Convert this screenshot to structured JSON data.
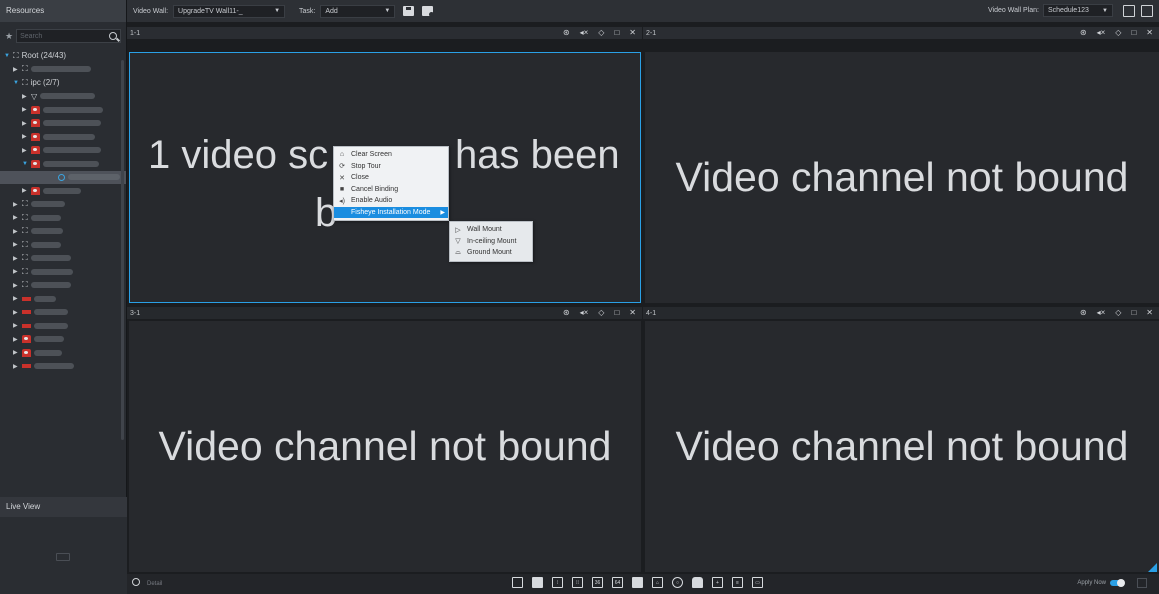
{
  "left_panel": {
    "title": "Resources",
    "search_placeholder": "Search",
    "tree": [
      {
        "label": "Root (24/43)",
        "level": 0,
        "icon": "network-icon",
        "open": true
      },
      {
        "label": "",
        "level": 1,
        "icon": "network-icon",
        "open": false,
        "blurred": true
      },
      {
        "label": "ipc (2/7)",
        "level": 1,
        "icon": "network-icon",
        "open": true
      },
      {
        "label": "",
        "level": 2,
        "icon": "fisheye-camera-icon",
        "open": false,
        "blurred": true
      },
      {
        "label": "",
        "level": 2,
        "icon": "red-camera-icon",
        "open": false,
        "blurred": true
      },
      {
        "label": "",
        "level": 2,
        "icon": "red-camera-icon",
        "open": false,
        "blurred": true
      },
      {
        "label": "",
        "level": 2,
        "icon": "red-camera-icon",
        "open": false,
        "blurred": true
      },
      {
        "label": "",
        "level": 2,
        "icon": "red-camera-icon",
        "open": false,
        "blurred": true
      },
      {
        "label": "",
        "level": 2,
        "icon": "red-camera-icon",
        "open": true,
        "blurred": true
      },
      {
        "label": "",
        "level": 3,
        "icon": "channel-icon",
        "selected": true,
        "blurred": true
      },
      {
        "label": "",
        "level": 2,
        "icon": "red-camera-icon",
        "open": false,
        "blurred": true
      },
      {
        "label": "",
        "level": 1,
        "icon": "network-icon",
        "open": false,
        "blurred": true
      },
      {
        "label": "",
        "level": 1,
        "icon": "network-icon",
        "open": false,
        "blurred": true
      },
      {
        "label": "",
        "level": 1,
        "icon": "network-icon",
        "open": false,
        "blurred": true
      },
      {
        "label": "",
        "level": 1,
        "icon": "network-icon",
        "open": false,
        "blurred": true
      },
      {
        "label": "",
        "level": 1,
        "icon": "network-icon",
        "open": false,
        "blurred": true
      },
      {
        "label": "",
        "level": 1,
        "icon": "network-icon",
        "open": false,
        "blurred": true
      },
      {
        "label": "",
        "level": 1,
        "icon": "network-icon",
        "open": false,
        "blurred": true
      },
      {
        "label": "",
        "level": 1,
        "icon": "device-flat-icon",
        "open": false,
        "blurred": true
      },
      {
        "label": "",
        "level": 1,
        "icon": "device-flat-icon",
        "open": false,
        "blurred": true
      },
      {
        "label": "",
        "level": 1,
        "icon": "device-flat-icon",
        "open": false,
        "blurred": true
      },
      {
        "label": "",
        "level": 1,
        "icon": "red-camera-icon",
        "open": false,
        "blurred": true
      },
      {
        "label": "",
        "level": 1,
        "icon": "red-camera-icon",
        "open": false,
        "blurred": true
      },
      {
        "label": "",
        "level": 1,
        "icon": "device-flat-icon",
        "open": false,
        "blurred": true
      }
    ],
    "live_view_title": "Live View"
  },
  "toolbar": {
    "video_wall_label": "Video Wall:",
    "video_wall_value": "UpgradeTV Wall11-_",
    "task_label": "Task:",
    "task_value": "Add",
    "plan_label": "Video Wall Plan:",
    "plan_value": "Schedule123"
  },
  "cells": [
    {
      "id": "1-1",
      "text_line1": "1 video sc",
      "text_line1b": "has been",
      "text_line2": "b",
      "active": true
    },
    {
      "id": "2-1",
      "text": "Video channel not bound"
    },
    {
      "id": "3-1",
      "text": "Video channel not bound"
    },
    {
      "id": "4-1",
      "text": "Video channel not bound"
    }
  ],
  "context_menu": {
    "items": [
      {
        "label": "Clear Screen",
        "icon": "clear-screen-icon"
      },
      {
        "label": "Stop Tour",
        "icon": "stop-tour-icon"
      },
      {
        "label": "Close",
        "icon": "close-icon"
      },
      {
        "label": "Cancel Binding",
        "icon": "lock-icon"
      },
      {
        "label": "Enable Audio",
        "icon": "audio-icon"
      },
      {
        "label": "Fisheye Installation Mode",
        "icon": "",
        "highlighted": true,
        "submenu": true
      }
    ],
    "submenu": [
      {
        "label": "Wall Mount",
        "icon": "wall-mount-icon"
      },
      {
        "label": "In-ceiling Mount",
        "icon": "ceiling-mount-icon"
      },
      {
        "label": "Ground Mount",
        "icon": "ground-mount-icon"
      }
    ]
  },
  "bottom": {
    "detail_label": "Detail",
    "apply_label": "Apply Now",
    "layout_icons": [
      "1",
      "4",
      "9",
      "16",
      "36",
      "64",
      "custom",
      "tour",
      "lock-a",
      "lock-b",
      "full",
      "list",
      "wall"
    ]
  },
  "colors": {
    "accent": "#2aa0e6",
    "menu_highlight": "#1a8de0",
    "camera_red": "#c9312b"
  }
}
